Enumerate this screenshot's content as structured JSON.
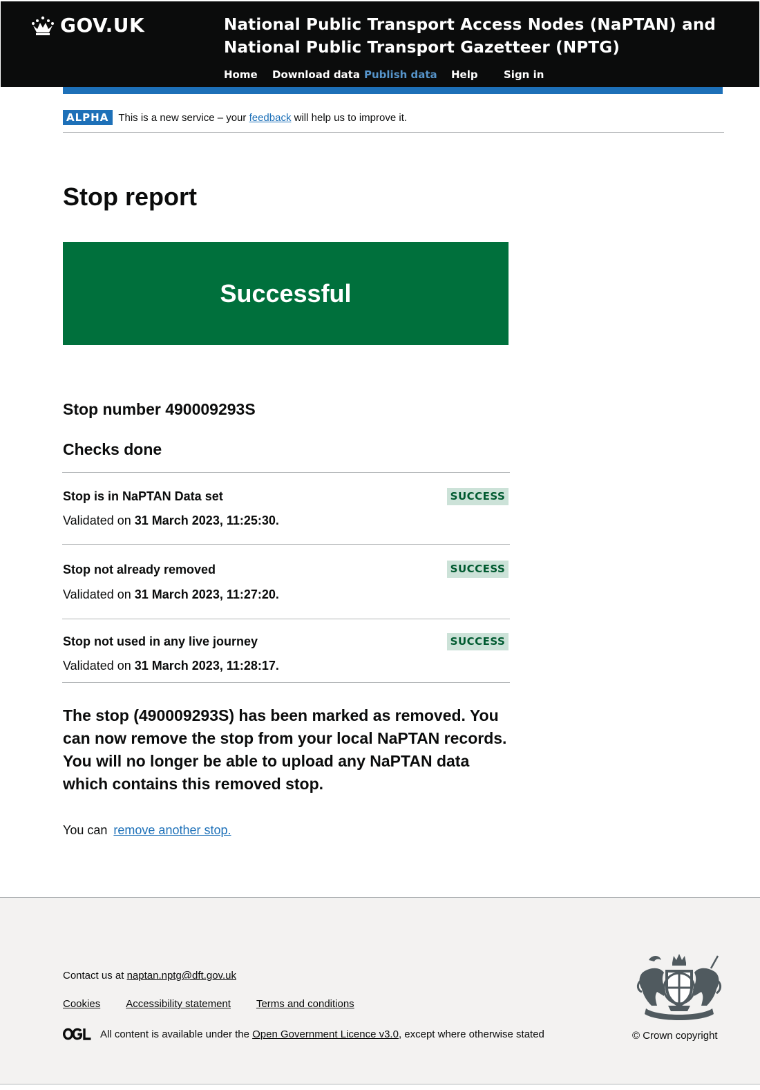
{
  "header": {
    "logo_text": "GOV.UK",
    "service_line1": "National Public Transport Access Nodes (NaPTAN) and",
    "service_line2": "National Public Transport Gazetteer (NPTG)",
    "nav": [
      {
        "label": "Home",
        "active": false
      },
      {
        "label": "Download data",
        "active": false
      },
      {
        "label": "Publish data",
        "active": true
      },
      {
        "label": "Help",
        "active": false
      },
      {
        "label": "Sign in",
        "active": false
      }
    ]
  },
  "phase_banner": {
    "tag": "ALPHA",
    "text_before": "This is a new service – your ",
    "link": "feedback",
    "text_after": " will help us to improve it."
  },
  "page_title": "Stop report",
  "panel": {
    "title": "Successful"
  },
  "stop_number": "Stop number 490009293S",
  "checks_heading": "Checks done",
  "checks": [
    {
      "name": "Stop is in NaPTAN Data set",
      "prefix": "Validated on ",
      "date": "31 March 2023, 11:25:30.",
      "status": "SUCCESS"
    },
    {
      "name": "Stop not already removed",
      "prefix": "Validated on ",
      "date": "31 March 2023, 11:27:20.",
      "status": "SUCCESS"
    },
    {
      "name": "Stop not used in any live journey",
      "prefix": "Validated on ",
      "date": "31 March 2023, 11:28:17.",
      "status": "SUCCESS"
    }
  ],
  "removed_message": "The stop (490009293S) has been marked as removed. You can now remove the stop from your local NaPTAN records. You will no longer be able to upload any NaPTAN data which contains this removed stop.",
  "another": {
    "prefix": "You can ",
    "link": "remove another stop."
  },
  "footer": {
    "contact_prefix": "Contact us at ",
    "contact_email": "naptan.nptg@dft.gov.uk",
    "links": [
      "Cookies",
      "Accessibility statement",
      "Terms and conditions"
    ],
    "licence_prefix": "All content is available under the ",
    "licence_link": "Open Government Licence v3.0",
    "licence_suffix": ", except where otherwise stated",
    "copyright": "© Crown copyright"
  },
  "colors": {
    "header_bg": "#0b0c0c",
    "accent_blue": "#1d70b8",
    "success_green": "#00703c",
    "tag_bg": "#cce2d8",
    "tag_text": "#005a30",
    "footer_bg": "#f3f2f1"
  },
  "icons": [
    "crown-icon",
    "ogl-logo",
    "royal-coat-of-arms"
  ]
}
